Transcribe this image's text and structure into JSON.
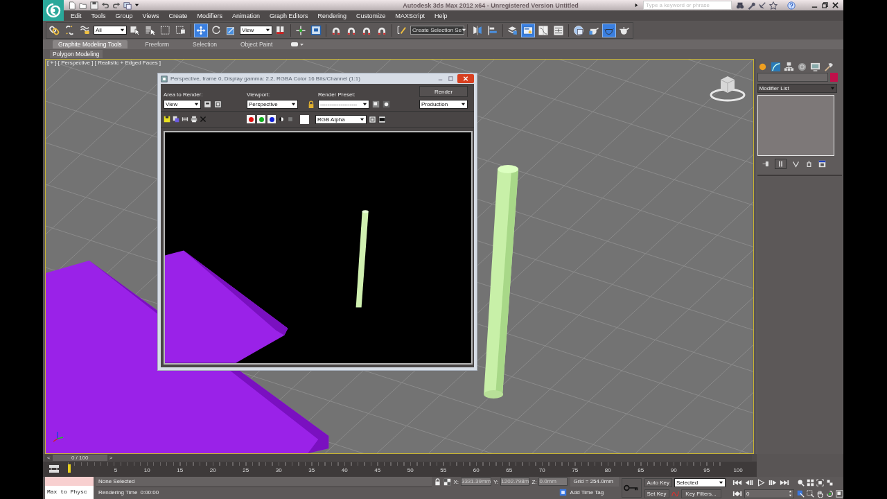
{
  "title_bar": {
    "title": "Autodesk 3ds Max 2012 x64  -  Unregistered Version   Untitled",
    "search": {
      "placeholder": "Type a keyword or phrase"
    }
  },
  "menu": [
    "Edit",
    "Tools",
    "Group",
    "Views",
    "Create",
    "Modifiers",
    "Animation",
    "Graph Editors",
    "Rendering",
    "Customize",
    "MAXScript",
    "Help"
  ],
  "main_toolbar": {
    "selection_filter": "All",
    "reference_coordinate": "View",
    "named_selection": "Create Selection Se",
    "buttons": [
      {
        "selected": false
      },
      {
        "selected": false
      },
      {
        "selected": false
      },
      {
        "selected": false
      },
      {
        "selected": false
      },
      {
        "selected": false
      },
      {
        "selected": false
      },
      {
        "selected": true
      },
      {
        "selected": false
      },
      {
        "selected": false
      },
      {
        "selected": false
      },
      {
        "selected": false
      },
      {
        "selected": false
      },
      {
        "selected": false
      },
      {
        "selected": false
      },
      {
        "selected": false
      },
      {
        "selected": false
      },
      {
        "selected": false
      },
      {
        "selected": false
      },
      {
        "selected": false
      },
      {
        "selected": false
      },
      {
        "selected": true
      },
      {
        "selected": false
      },
      {
        "selected": false
      },
      {
        "selected": false
      },
      {
        "selected": false
      },
      {
        "selected": true
      },
      {
        "selected": false
      }
    ]
  },
  "ribbon": {
    "tabs": [
      {
        "label": "Graphite Modeling Tools",
        "selected": true
      },
      {
        "label": "Freeform",
        "selected": false
      },
      {
        "label": "Selection",
        "selected": false
      },
      {
        "label": "Object Paint",
        "selected": false
      }
    ],
    "panel": "Polygon Modeling"
  },
  "viewport": {
    "label": "[ + ] [ Perspective ] [ Realistic + Edged Faces ]",
    "active": true
  },
  "render_window": {
    "title": "Perspective, frame 0, Display gamma: 2.2, RGBA Color 16 Bits/Channel (1:1)",
    "area_label": "Area to Render:",
    "area": "View",
    "viewport_label": "Viewport:",
    "viewport": "Perspective",
    "preset_label": "Render Preset:",
    "preset": "--------------------",
    "render_button": "Render",
    "mode": "Production",
    "display_channel": "RGB Alpha",
    "channel_toggles": [
      {
        "color": "#e01010"
      },
      {
        "color": "#10b020"
      },
      {
        "color": "#1020d8"
      }
    ]
  },
  "command_panel": {
    "modifier_list": "Modifier List"
  },
  "time_slider": {
    "previous": "<",
    "label": "0 / 100",
    "next": ">",
    "level": 0
  },
  "track_bar": {
    "ticks": [
      "5",
      "10",
      "15",
      "20",
      "25",
      "30",
      "35",
      "40",
      "45",
      "50",
      "55",
      "60",
      "65",
      "70",
      "75",
      "80",
      "85",
      "90",
      "95",
      "100"
    ]
  },
  "status_bar": {
    "listener": "Max to Physc",
    "prompt": "None Selected",
    "rendering_time_label": "Rendering Time",
    "rendering_time": "0:00:00",
    "x_label": "X:",
    "x": "3331.39mm",
    "y_label": "Y:",
    "y": "1202.798m",
    "z_label": "Z:",
    "z": "0.0mm",
    "grid": "Grid = 254.0mm",
    "time_tag": "Add Time Tag",
    "auto_key": "Auto Key",
    "key_mode": "Selected",
    "set_key": "Set Key",
    "key_filters": "Key Filters...",
    "frame": "0"
  }
}
